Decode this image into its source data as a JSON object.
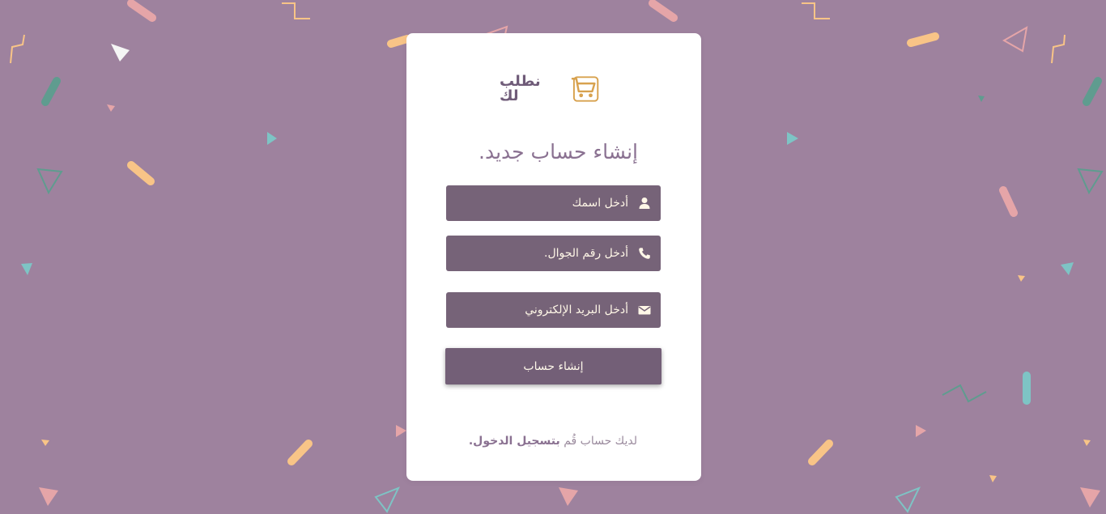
{
  "colors": {
    "background": "#9e829e",
    "card": "#ffffff",
    "field": "#766378",
    "button": "#735f77",
    "title": "#8a7191",
    "field_text": "#fff7e7",
    "confetti_yellow": "#f8c487",
    "confetti_pink": "#e5a5a8",
    "confetti_teal": "#5f9c8f",
    "confetti_cyan": "#7ec4c5",
    "confetti_white": "#f5f5f5"
  },
  "brand": {
    "name": "نطلب لك",
    "logo_icon": "shopping-cart-icon"
  },
  "form": {
    "title": "إنشاء حساب جديد.",
    "name_placeholder": "أدخل اسمك",
    "name_icon": "user-icon",
    "phone_placeholder": "أدخل رقم الجوال.",
    "phone_icon": "phone-icon",
    "email_placeholder": "أدخل البريد الإلكتروني",
    "email_icon": "envelope-icon",
    "submit_label": "إنشاء حساب"
  },
  "footer": {
    "prefix": "لديك حساب قُم",
    "link_text": "بتسجيل الدخول."
  }
}
